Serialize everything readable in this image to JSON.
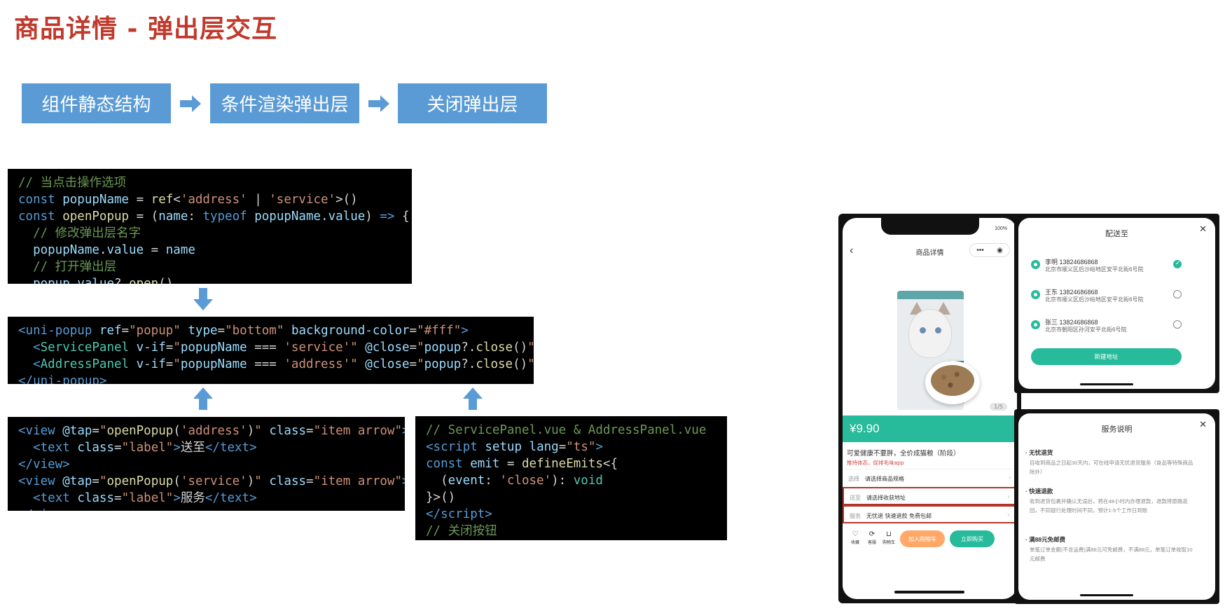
{
  "title": "商品详情 - 弹出层交互",
  "steps": [
    "组件静态结构",
    "条件渲染弹出层",
    "关闭弹出层"
  ],
  "colors": {
    "title": "#c0392b",
    "step_bg": "#5b9bd5",
    "accent": "#27ba9b",
    "highlight": "#b5342a"
  },
  "phone": {
    "battery": "100%",
    "nav_title": "商品详情",
    "page_indicator": "1/5",
    "price": "¥9.90",
    "product_name": "可爱健康不要胖，全价成猫粮（阶段）",
    "product_sub": "推持体态，促排毛味app",
    "options": [
      {
        "key": "选择",
        "value": "请选择商品规格"
      },
      {
        "key": "送至",
        "value": "请选择收获地址"
      },
      {
        "key": "服务",
        "value": "无忧退 快速退款 免费包邮"
      }
    ],
    "bottom_icons": [
      "收藏",
      "客服",
      "购物车"
    ],
    "btn_cart": "加入购物车",
    "btn_buy": "立即购买"
  },
  "address_panel": {
    "title": "配送至",
    "addresses": [
      {
        "name": "李明 13824686868",
        "line": "北京市顺义区后沙峪地区安平北街6号院"
      },
      {
        "name": "王东 13824686868",
        "line": "北京市顺义区后沙峪地区安平北街6号院"
      },
      {
        "name": "张三 13824686868",
        "line": "北京市朝阳区孙河安平北街6号院"
      }
    ],
    "button": "新建地址"
  },
  "service_panel": {
    "title": "服务说明",
    "items": [
      {
        "head": "无忧退货",
        "desc": "自收到商品之日起30天内，可在线申请无忧退货服务（食品等特殊商品除外）"
      },
      {
        "head": "快速退款",
        "desc": "收到退货包裹并确认无误后，将在48小时内办理退款，退款将原路返回，不同银行处理时间不同，预计1-5个工作日到账"
      },
      {
        "head": "满88元免邮费",
        "desc": "单笔订单金额(不含运费)满88元可免邮费，不满88元，单笔订单收取10元邮费"
      }
    ]
  }
}
